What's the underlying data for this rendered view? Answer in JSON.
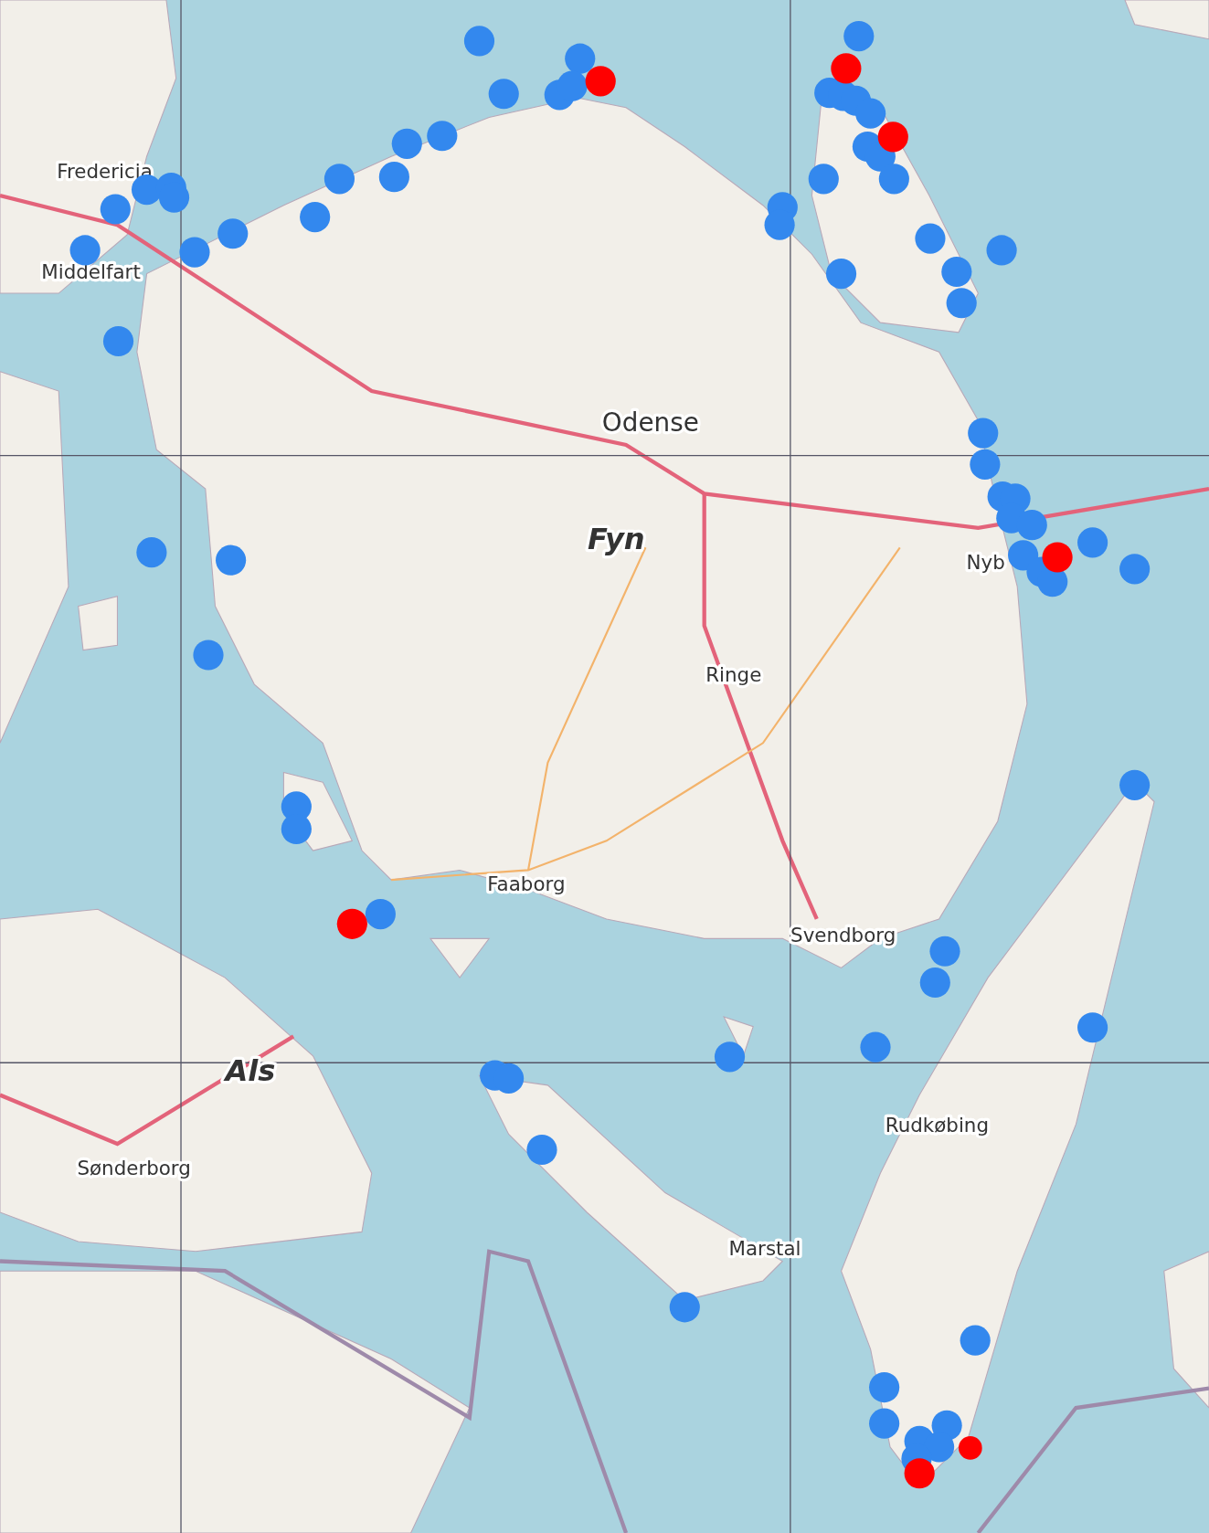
{
  "map": {
    "labels": [
      {
        "text": "Fredericia",
        "kind": "town"
      },
      {
        "text": "Middelfart",
        "kind": "town"
      },
      {
        "text": "Odense",
        "kind": "city"
      },
      {
        "text": "Fyn",
        "kind": "island"
      },
      {
        "text": "Nyb",
        "kind": "town"
      },
      {
        "text": "Ringe",
        "kind": "town"
      },
      {
        "text": "Faaborg",
        "kind": "town"
      },
      {
        "text": "Svendborg",
        "kind": "town"
      },
      {
        "text": "Als",
        "kind": "island"
      },
      {
        "text": "Sønderborg",
        "kind": "town"
      },
      {
        "text": "Rudkøbing",
        "kind": "town"
      },
      {
        "text": "Marstal",
        "kind": "town"
      }
    ],
    "markers": [
      {
        "color": "#3388ee"
      },
      {
        "color": "#3388ee"
      },
      {
        "color": "#3388ee"
      },
      {
        "color": "#3388ee"
      },
      {
        "color": "#3388ee"
      },
      {
        "color": "#3388ee"
      },
      {
        "color": "#3388ee"
      },
      {
        "color": "#3388ee"
      },
      {
        "color": "#3388ee"
      },
      {
        "color": "#3388ee"
      },
      {
        "color": "#3388ee"
      },
      {
        "color": "#3388ee"
      },
      {
        "color": "#3388ee"
      },
      {
        "color": "#3388ee"
      },
      {
        "color": "#3388ee"
      },
      {
        "color": "#3388ee"
      },
      {
        "color": "#3388ee"
      },
      {
        "color": "#3388ee"
      },
      {
        "color": "#3388ee"
      },
      {
        "color": "#3388ee"
      },
      {
        "color": "#3388ee"
      },
      {
        "color": "#3388ee"
      },
      {
        "color": "#3388ee"
      },
      {
        "color": "#3388ee"
      },
      {
        "color": "#3388ee"
      },
      {
        "color": "#3388ee"
      },
      {
        "color": "#3388ee"
      },
      {
        "color": "#3388ee"
      },
      {
        "color": "#3388ee"
      },
      {
        "color": "#3388ee"
      },
      {
        "color": "#3388ee"
      },
      {
        "color": "#3388ee"
      },
      {
        "color": "#3388ee"
      },
      {
        "color": "#3388ee"
      },
      {
        "color": "#3388ee"
      },
      {
        "color": "#3388ee"
      },
      {
        "color": "#3388ee"
      },
      {
        "color": "#3388ee"
      },
      {
        "color": "#3388ee"
      },
      {
        "color": "#3388ee"
      },
      {
        "color": "#3388ee"
      },
      {
        "color": "#3388ee"
      },
      {
        "color": "#3388ee"
      },
      {
        "color": "#3388ee"
      },
      {
        "color": "#3388ee"
      },
      {
        "color": "#3388ee"
      },
      {
        "color": "#3388ee"
      },
      {
        "color": "#3388ee"
      },
      {
        "color": "#3388ee"
      },
      {
        "color": "#3388ee"
      },
      {
        "color": "#3388ee"
      },
      {
        "color": "#3388ee"
      },
      {
        "color": "#3388ee"
      },
      {
        "color": "#3388ee"
      },
      {
        "color": "#3388ee"
      },
      {
        "color": "#3388ee"
      },
      {
        "color": "#3388ee"
      },
      {
        "color": "#3388ee"
      },
      {
        "color": "#3388ee"
      },
      {
        "color": "#3388ee"
      },
      {
        "color": "#3388ee"
      },
      {
        "color": "#3388ee"
      },
      {
        "color": "#3388ee"
      },
      {
        "color": "#3388ee"
      },
      {
        "color": "#3388ee"
      },
      {
        "color": "#3388ee"
      },
      {
        "color": "#3388ee"
      },
      {
        "color": "#3388ee"
      },
      {
        "color": "#ff0000"
      },
      {
        "color": "#ff0000"
      },
      {
        "color": "#ff0000"
      },
      {
        "color": "#ff0000"
      },
      {
        "color": "#ff0000"
      },
      {
        "color": "#ff0000"
      },
      {
        "color": "#ff0000"
      }
    ]
  }
}
